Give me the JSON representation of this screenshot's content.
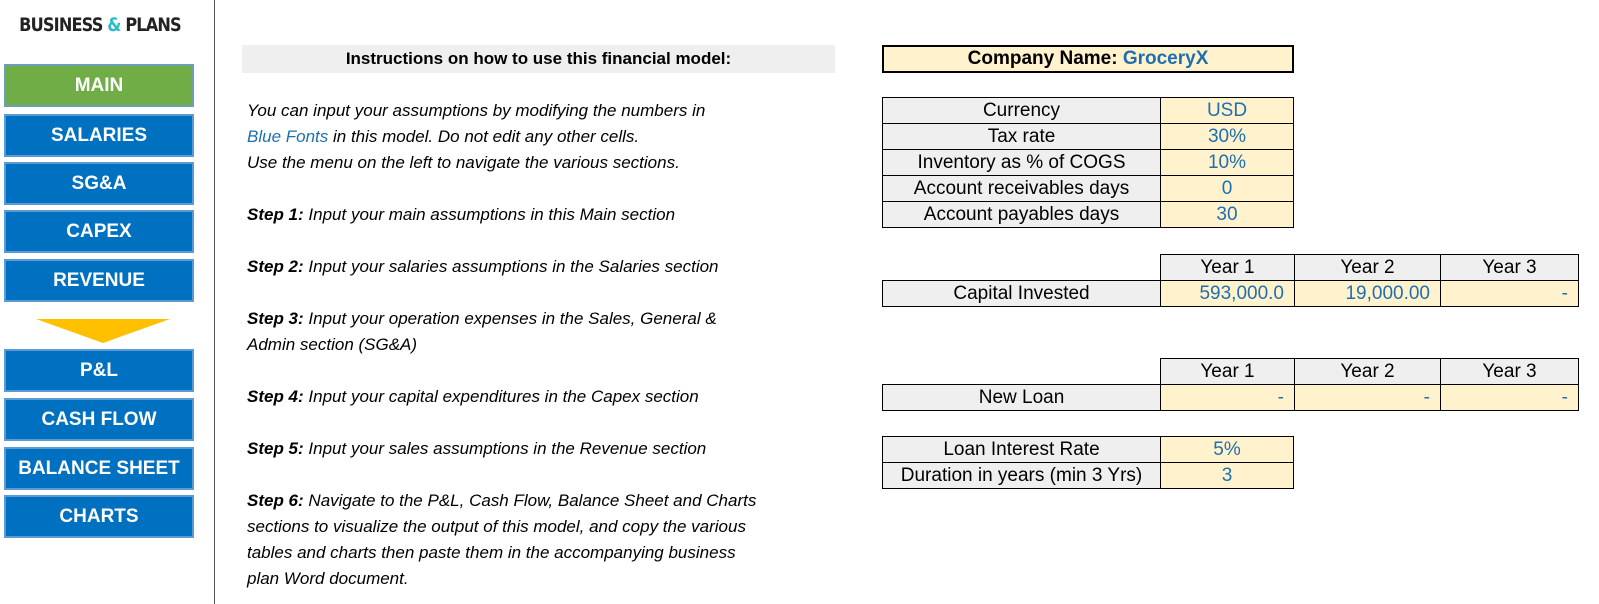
{
  "logo": {
    "left": "BUSINESS",
    "amp": "&",
    "right": "PLANS"
  },
  "nav": {
    "items": [
      {
        "label": "MAIN",
        "active": true
      },
      {
        "label": "SALARIES"
      },
      {
        "label": "SG&A"
      },
      {
        "label": "CAPEX"
      },
      {
        "label": "REVENUE"
      },
      {
        "label": "P&L"
      },
      {
        "label": "CASH FLOW"
      },
      {
        "label": "BALANCE SHEET"
      },
      {
        "label": "CHARTS"
      }
    ],
    "arrow_icon": "arrow-down-icon"
  },
  "instructions": {
    "title": "Instructions on how to use this financial model:",
    "intro1": "You can input your assumptions by modifying the numbers in",
    "intro2_blue": "Blue Fonts",
    "intro2_rest": " in this model. Do not edit any other cells.",
    "intro3": "Use the menu on the left to navigate the various sections.",
    "steps": [
      {
        "label": "Step 1:",
        "text": " Input your main assumptions in this Main section"
      },
      {
        "label": "Step 2:",
        "text": " Input your salaries assumptions in the Salaries section"
      },
      {
        "label": "Step 3:",
        "text": " Input your operation expenses in the Sales, General &",
        "cont": "Admin section (SG&A)"
      },
      {
        "label": "Step 4:",
        "text": " Input your capital expenditures in the Capex section"
      },
      {
        "label": "Step 5:",
        "text": " Input your sales assumptions in the Revenue section"
      },
      {
        "label": "Step 6:",
        "text": " Navigate to the P&L, Cash Flow, Balance Sheet and Charts",
        "cont1": "sections to visualize the output of this model, and copy the various",
        "cont2": "tables and charts then paste them in the accompanying business",
        "cont3": "plan Word document."
      }
    ]
  },
  "company": {
    "label": "Company Name: ",
    "value": "GroceryX"
  },
  "assumptions": [
    {
      "label": "Currency",
      "value": "USD"
    },
    {
      "label": "Tax rate",
      "value": "30%"
    },
    {
      "label": "Inventory as % of COGS",
      "value": "10%"
    },
    {
      "label": "Account receivables days",
      "value": "0"
    },
    {
      "label": "Account payables days",
      "value": "30"
    }
  ],
  "capital": {
    "headers": [
      "Year 1",
      "Year 2",
      "Year 3"
    ],
    "label": "Capital Invested",
    "values": [
      "593,000.0",
      "19,000.00",
      "-"
    ]
  },
  "loan": {
    "headers": [
      "Year 1",
      "Year 2",
      "Year 3"
    ],
    "label": "New Loan",
    "values": [
      "-",
      "-",
      "-"
    ]
  },
  "loan_terms": [
    {
      "label": "Loan Interest Rate",
      "value": "5%"
    },
    {
      "label": "Duration in years (min 3 Yrs)",
      "value": "3"
    }
  ],
  "colors": {
    "nav_blue": "#0070c0",
    "nav_active": "#70ad47",
    "input_blue": "#1f6fb0",
    "input_bg": "#fff2cc",
    "arrow": "#ffc000"
  }
}
